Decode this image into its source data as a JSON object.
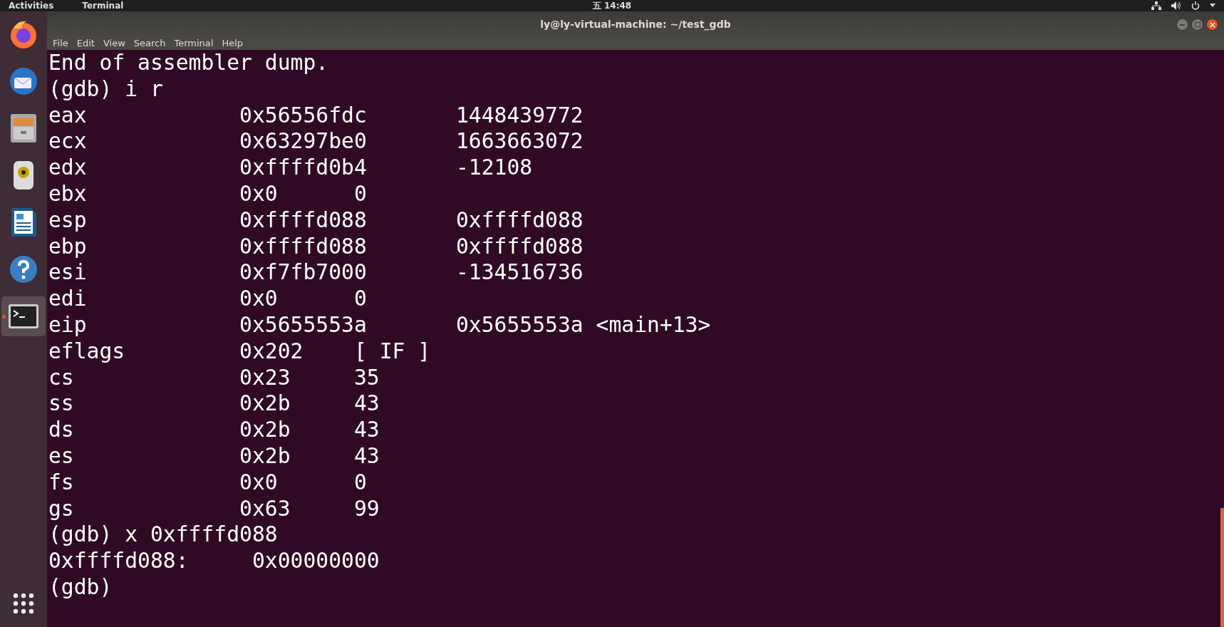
{
  "top_bar": {
    "activities": "Activities",
    "app_menu": "Terminal",
    "clock": "五 14:48"
  },
  "window": {
    "title": "ly@ly-virtual-machine: ~/test_gdb"
  },
  "menu": [
    "File",
    "Edit",
    "View",
    "Search",
    "Terminal",
    "Help"
  ],
  "dock": {
    "items": [
      {
        "kind": "firefox",
        "running": false
      },
      {
        "kind": "mail",
        "running": false
      },
      {
        "kind": "files",
        "running": false
      },
      {
        "kind": "speaker",
        "running": false
      },
      {
        "kind": "writer",
        "running": false
      },
      {
        "kind": "help",
        "running": false
      },
      {
        "kind": "terminal",
        "running": true
      }
    ]
  },
  "terminal": {
    "lines": [
      {
        "kind": "text",
        "text": "End of assembler dump."
      },
      {
        "kind": "text",
        "text": "(gdb) i r"
      },
      {
        "kind": "register",
        "name": "eax",
        "hex": "0x56556fdc",
        "natural": "1448439772"
      },
      {
        "kind": "register",
        "name": "ecx",
        "hex": "0x63297be0",
        "natural": "1663663072"
      },
      {
        "kind": "register",
        "name": "edx",
        "hex": "0xffffd0b4",
        "natural": "-12108"
      },
      {
        "kind": "register",
        "name": "ebx",
        "hex": "0x0",
        "natural": "0"
      },
      {
        "kind": "register",
        "name": "esp",
        "hex": "0xffffd088",
        "natural": "0xffffd088"
      },
      {
        "kind": "register",
        "name": "ebp",
        "hex": "0xffffd088",
        "natural": "0xffffd088"
      },
      {
        "kind": "register",
        "name": "esi",
        "hex": "0xf7fb7000",
        "natural": "-134516736"
      },
      {
        "kind": "register",
        "name": "edi",
        "hex": "0x0",
        "natural": "0"
      },
      {
        "kind": "register",
        "name": "eip",
        "hex": "0x5655553a",
        "natural": "0x5655553a <main+13>"
      },
      {
        "kind": "register",
        "name": "eflags",
        "hex": "0x202",
        "natural": "[ IF ]"
      },
      {
        "kind": "register",
        "name": "cs",
        "hex": "0x23",
        "natural": "35"
      },
      {
        "kind": "register",
        "name": "ss",
        "hex": "0x2b",
        "natural": "43"
      },
      {
        "kind": "register",
        "name": "ds",
        "hex": "0x2b",
        "natural": "43"
      },
      {
        "kind": "register",
        "name": "es",
        "hex": "0x2b",
        "natural": "43"
      },
      {
        "kind": "register",
        "name": "fs",
        "hex": "0x0",
        "natural": "0"
      },
      {
        "kind": "register",
        "name": "gs",
        "hex": "0x63",
        "natural": "99"
      },
      {
        "kind": "text",
        "text": "(gdb) x 0xffffd088"
      },
      {
        "kind": "memory",
        "address": "0xffffd088:",
        "value": "0x00000000"
      },
      {
        "kind": "text",
        "text": "(gdb)"
      }
    ]
  }
}
